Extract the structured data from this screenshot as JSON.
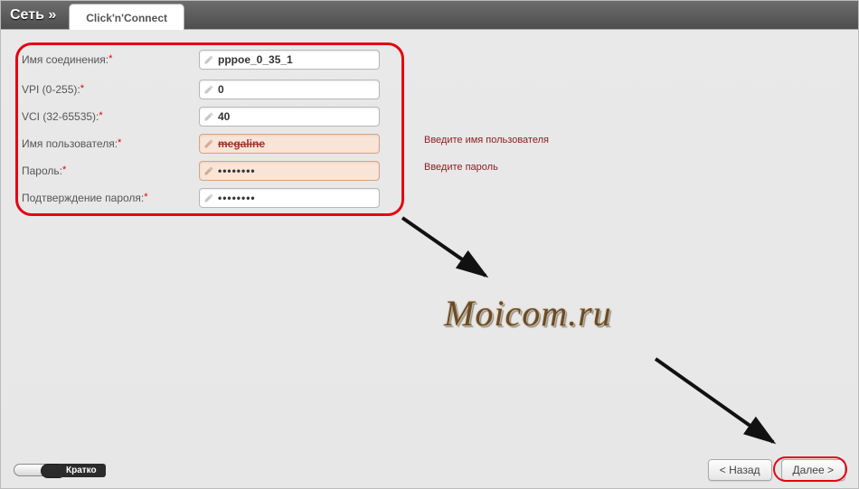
{
  "tabs": {
    "network_label": "Сеть »",
    "active_tab": "Click'n'Connect"
  },
  "form": {
    "rows": {
      "conn_name": {
        "label": "Имя соединения:",
        "value": "pppoe_0_35_1"
      },
      "vpi": {
        "label": "VPI (0-255):",
        "value": "0"
      },
      "vci": {
        "label": "VCI (32-65535):",
        "value": "40"
      },
      "username": {
        "label": "Имя пользователя:",
        "value": "megaline"
      },
      "password": {
        "label": "Пароль:",
        "value": "••••••••"
      },
      "password2": {
        "label": "Подтверждение пароля:",
        "value": "••••••••"
      }
    },
    "errors": {
      "username": "Введите имя пользователя",
      "password": "Введите пароль"
    }
  },
  "watermark": "Moicom.ru",
  "footer": {
    "toggle_label": "Кратко",
    "back": "< Назад",
    "next": "Далее >"
  }
}
